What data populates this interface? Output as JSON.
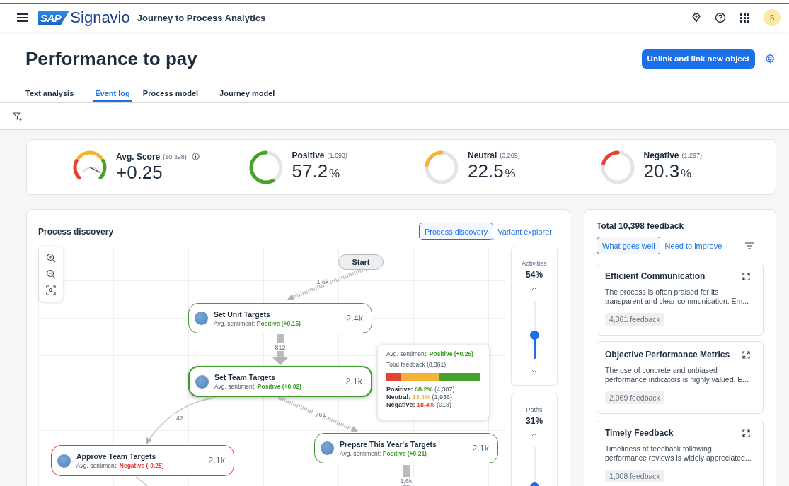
{
  "header": {
    "logo_mark": "SAP",
    "logo_word": "Signavio",
    "app_title": "Journey to Process Analytics",
    "avatar": "S"
  },
  "page": {
    "title": "Performance to pay",
    "primary_button": "Unlink and link new object"
  },
  "tabs": [
    {
      "label": "Text analysis",
      "selected": false
    },
    {
      "label": "Event log",
      "selected": true
    },
    {
      "label": "Process model",
      "selected": false
    },
    {
      "label": "Journey model",
      "selected": false
    }
  ],
  "kpis": [
    {
      "kind": "gauge",
      "label": "Avg. Score",
      "count": "(10,398)",
      "value": "+0.25"
    },
    {
      "kind": "donut",
      "label": "Positive",
      "count": "(1,693)",
      "value": "57.2",
      "unit": "%",
      "level": 0.572,
      "color": "#4aa02c"
    },
    {
      "kind": "donut",
      "label": "Neutral",
      "count": "(3,269)",
      "value": "22.5",
      "unit": "%",
      "level": 0.225,
      "color": "#f5b335"
    },
    {
      "kind": "donut",
      "label": "Negative",
      "count": "(1,297)",
      "value": "20.3",
      "unit": "%",
      "level": 0.203,
      "color": "#e34234"
    }
  ],
  "process": {
    "title": "Process discovery",
    "views": [
      {
        "label": "Process discovery",
        "selected": true
      },
      {
        "label": "Variant explorer",
        "selected": false
      }
    ],
    "nodes": [
      {
        "kind": "start",
        "label": "Start"
      },
      {
        "kind": "activity",
        "label": "Set Unit Targets",
        "sentiment_prefix": "Avg. sentiment:",
        "sentiment_text": "Positive (+0.15)",
        "color": "#3f9a2e",
        "count": "2.4k",
        "selected": false
      },
      {
        "kind": "activity",
        "label": "Set Team Targets",
        "sentiment_prefix": "Avg. sentiment:",
        "sentiment_text": "Positive (+0.02)",
        "color": "#3f9a2e",
        "count": "2.1k",
        "selected": true
      },
      {
        "kind": "activity",
        "label": "Approve Team Targets",
        "sentiment_prefix": "Avg. sentiment:",
        "sentiment_text": "Negative (-0.25)",
        "color": "#e53935",
        "count": "2.1k",
        "selected": false
      },
      {
        "kind": "activity",
        "label": "Prepare This Year's Targets",
        "sentiment_prefix": "Avg. sentiment:",
        "sentiment_text": "Positive (+0.21)",
        "color": "#3f9a2e",
        "count": "2.1k",
        "selected": false
      }
    ],
    "edges": [
      {
        "kind": "hatched",
        "label": "1,6k"
      },
      {
        "kind": "block",
        "label": "812"
      },
      {
        "kind": "hatched",
        "label": "761"
      },
      {
        "kind": "curve",
        "label": "42"
      },
      {
        "kind": "block",
        "label": "1,6k"
      },
      {
        "kind": "curve"
      }
    ],
    "tooltip": {
      "sentiment_prefix": "Avg. sentiment:",
      "sentiment_text": "Positive (+0.25)",
      "color": "#3f9a2e",
      "total": "Total feedback (8,361)",
      "segments": [
        {
          "color": "#e34234"
        },
        {
          "color": "#f5b335"
        },
        {
          "color": "#4aa02c"
        }
      ],
      "rows": [
        {
          "label": "Positive:",
          "percent": "68.2%",
          "count": "(4,307)",
          "color": "#4aa02c"
        },
        {
          "label": "Neutral:",
          "percent": "13.4%",
          "count": "(1,936)",
          "color": "#f5b335"
        },
        {
          "label": "Negative:",
          "percent": "18.4%",
          "count": "(918)",
          "color": "#e34234"
        }
      ]
    },
    "sliders": [
      {
        "label": "Activities",
        "value": "54%",
        "level": 0.4
      },
      {
        "label": "Paths",
        "value": "31%",
        "level": 0.3
      }
    ]
  },
  "feedback": {
    "title": "Total 10,398 feedback",
    "views": [
      {
        "label": "What goes well",
        "selected": true
      },
      {
        "label": "Need to improve",
        "selected": false
      }
    ],
    "cards": [
      {
        "title": "Efficient Communication",
        "text": "The process is often praised for its transparent and clear communication. Em...",
        "count": "4,361 feedback"
      },
      {
        "title": "Objective Performance Metrics",
        "text": "The use of concrete and unbiased performance indicators is highly valued. E...",
        "count": "2,069 feedback"
      },
      {
        "title": "Timely Feedback",
        "text": "Timeliness of feedback following performance reviews is widely appreciated...",
        "count": "1,008 feedback"
      }
    ]
  }
}
